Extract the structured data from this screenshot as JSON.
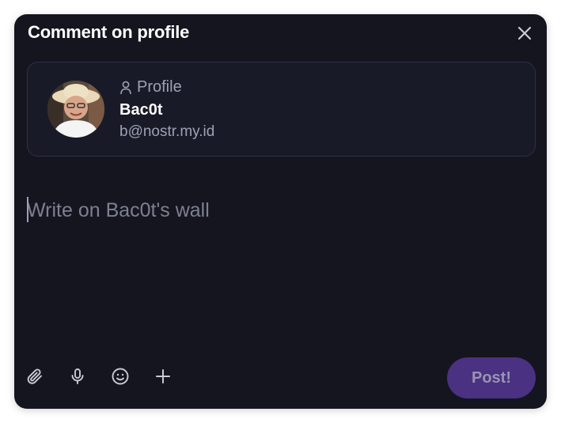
{
  "dialog": {
    "title": "Comment on profile",
    "close_icon": "close-icon"
  },
  "profile_card": {
    "kind_label": "Profile",
    "kind_icon": "user-icon",
    "name": "Bac0t",
    "nip05": "b@nostr.my.id"
  },
  "editor": {
    "value": "",
    "placeholder": "Write on Bac0t's wall"
  },
  "toolbar": {
    "attach_icon": "paperclip-icon",
    "mic_icon": "microphone-icon",
    "emoji_icon": "emoji-icon",
    "add_icon": "plus-icon",
    "post_label": "Post!"
  },
  "colors": {
    "background": "#14151f",
    "card_border": "#2f3045",
    "accent": "#4a3181",
    "muted_text": "#9ea0b4"
  }
}
